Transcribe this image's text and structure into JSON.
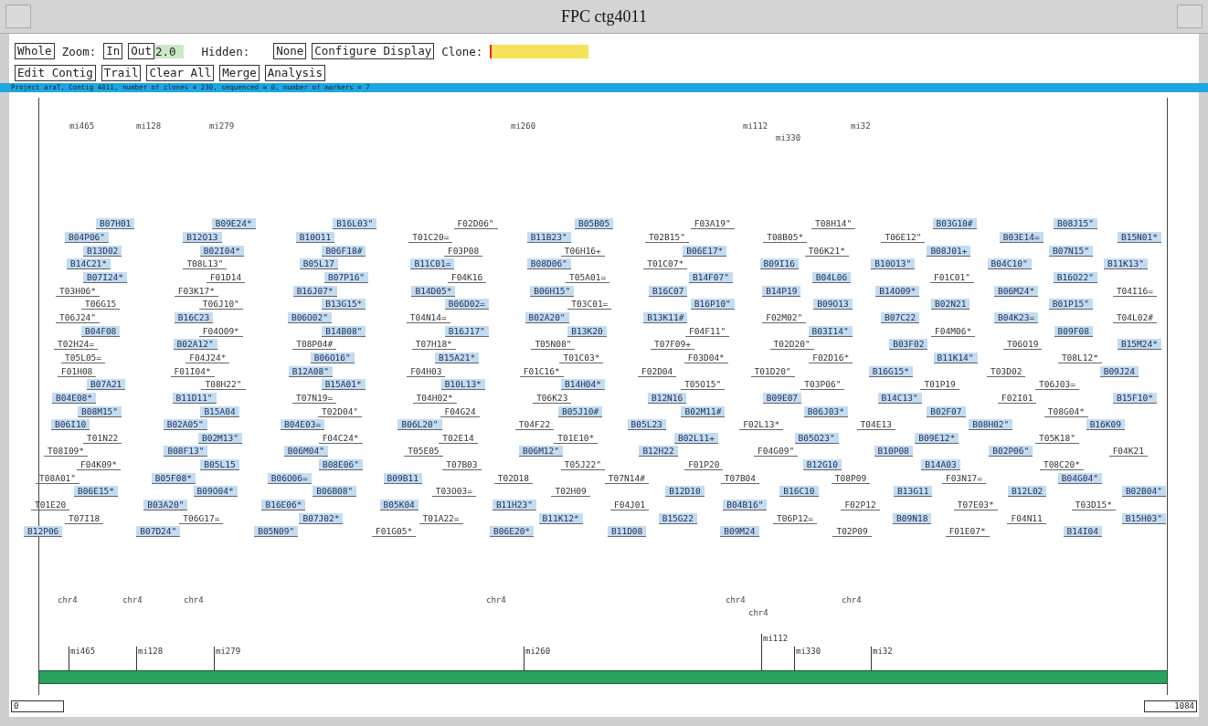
{
  "window": {
    "title": "FPC ctg4011"
  },
  "toolbar": [
    [
      {
        "kind": "button",
        "text": "Whole"
      },
      {
        "kind": "label",
        "text": "Zoom:"
      },
      {
        "kind": "button",
        "text": "In"
      },
      {
        "kind": "button",
        "text": "Out"
      },
      {
        "kind": "value",
        "text": "2.0"
      },
      {
        "kind": "label",
        "text": "Hidden:"
      },
      {
        "kind": "button",
        "text": "None"
      },
      {
        "kind": "button",
        "text": "Configure Display"
      },
      {
        "kind": "label",
        "text": "Clone:"
      },
      {
        "kind": "field"
      }
    ],
    [
      {
        "kind": "button",
        "text": "Edit Contig"
      },
      {
        "kind": "button",
        "text": "Trail"
      },
      {
        "kind": "button",
        "text": "Clear All"
      },
      {
        "kind": "button",
        "text": "Merge"
      },
      {
        "kind": "button",
        "text": "Analysis"
      }
    ]
  ],
  "status_line": "Project araT, Contig 4011, number of clones = 230, sequenced = 0, number of markers = 7",
  "marker_rows": [
    [
      "mi465",
      "mi128",
      "mi279",
      "mi260",
      "mi112",
      "mi32"
    ],
    [
      "mi330"
    ]
  ],
  "clone_rows": [
    [
      {
        "name": "B07H01",
        "highlighted": true
      },
      {
        "name": "B09E24*",
        "highlighted": true
      },
      {
        "name": "B16L03\"",
        "highlighted": true
      },
      {
        "name": "F02D06\"",
        "highlighted": false
      },
      {
        "name": "B05B05",
        "highlighted": true
      },
      {
        "name": "F03A19\"",
        "highlighted": false
      },
      {
        "name": "T08H14\"",
        "highlighted": false
      },
      {
        "name": "B03G10#",
        "highlighted": true
      },
      {
        "name": "B08J15\"",
        "highlighted": true
      }
    ],
    [
      {
        "name": "B04P06\"",
        "highlighted": true
      },
      {
        "name": "B12O13",
        "highlighted": true
      },
      {
        "name": "B10O11",
        "highlighted": true
      },
      {
        "name": "T01C20=",
        "highlighted": false
      },
      {
        "name": "B11B23\"",
        "highlighted": true
      },
      {
        "name": "T02B15\"",
        "highlighted": false
      },
      {
        "name": "T08B05*",
        "highlighted": false
      },
      {
        "name": "T06E12\"",
        "highlighted": false
      },
      {
        "name": "B03E14=",
        "highlighted": true
      },
      {
        "name": "B15N01*",
        "highlighted": true
      }
    ],
    [
      {
        "name": "B13D02",
        "highlighted": true
      },
      {
        "name": "B02I04*",
        "highlighted": true
      },
      {
        "name": "B06F18#",
        "highlighted": true
      },
      {
        "name": "F03P08",
        "highlighted": false
      },
      {
        "name": "T06H16+",
        "highlighted": false
      },
      {
        "name": "B06E17*",
        "highlighted": true
      },
      {
        "name": "T06K21*",
        "highlighted": false
      },
      {
        "name": "B08J01+",
        "highlighted": true
      },
      {
        "name": "B07N15\"",
        "highlighted": true
      }
    ],
    [
      {
        "name": "B14C21*",
        "highlighted": true
      },
      {
        "name": "T08L13\"",
        "highlighted": false
      },
      {
        "name": "B05L17",
        "highlighted": true
      },
      {
        "name": "B11C01=",
        "highlighted": true
      },
      {
        "name": "B08D06\"",
        "highlighted": true
      },
      {
        "name": "T01C07*",
        "highlighted": false
      },
      {
        "name": "B09I16",
        "highlighted": true
      },
      {
        "name": "B10O13\"",
        "highlighted": true
      },
      {
        "name": "B04C10\"",
        "highlighted": true
      },
      {
        "name": "B11K13\"",
        "highlighted": true
      }
    ],
    [
      {
        "name": "B07I24*",
        "highlighted": true
      },
      {
        "name": "F01D14",
        "highlighted": false
      },
      {
        "name": "B07P16\"",
        "highlighted": true
      },
      {
        "name": "F04K16",
        "highlighted": false
      },
      {
        "name": "T05A01=",
        "highlighted": false
      },
      {
        "name": "B14F07\"",
        "highlighted": true
      },
      {
        "name": "B04L06",
        "highlighted": true
      },
      {
        "name": "F01C01\"",
        "highlighted": false
      },
      {
        "name": "B16O22\"",
        "highlighted": true
      }
    ],
    [
      {
        "name": "T03H06*",
        "highlighted": false
      },
      {
        "name": "F03K17*",
        "highlighted": false
      },
      {
        "name": "B16J07*",
        "highlighted": true
      },
      {
        "name": "B14D05*",
        "highlighted": true
      },
      {
        "name": "B06H15\"",
        "highlighted": true
      },
      {
        "name": "B16C07",
        "highlighted": true
      },
      {
        "name": "B14P19",
        "highlighted": true
      },
      {
        "name": "B14O09*",
        "highlighted": true
      },
      {
        "name": "B06M24*",
        "highlighted": true
      },
      {
        "name": "T04I16=",
        "highlighted": false
      }
    ],
    [
      {
        "name": "T06G15",
        "highlighted": false
      },
      {
        "name": "T06J10\"",
        "highlighted": false
      },
      {
        "name": "B13G15*",
        "highlighted": true
      },
      {
        "name": "B06D02=",
        "highlighted": true
      },
      {
        "name": "T03C01=",
        "highlighted": false
      },
      {
        "name": "B16P10\"",
        "highlighted": true
      },
      {
        "name": "B09O13",
        "highlighted": true
      },
      {
        "name": "B02N21",
        "highlighted": true
      },
      {
        "name": "B01P15\"",
        "highlighted": true
      }
    ],
    [
      {
        "name": "T06J24\"",
        "highlighted": false
      },
      {
        "name": "B16C23",
        "highlighted": true
      },
      {
        "name": "B06O02\"",
        "highlighted": true
      },
      {
        "name": "T04N14=",
        "highlighted": false
      },
      {
        "name": "B02A20\"",
        "highlighted": true
      },
      {
        "name": "B13K11#",
        "highlighted": true
      },
      {
        "name": "F02M02\"",
        "highlighted": false
      },
      {
        "name": "B07C22",
        "highlighted": true
      },
      {
        "name": "B04K23=",
        "highlighted": true
      },
      {
        "name": "T04L02#",
        "highlighted": false
      }
    ],
    [
      {
        "name": "B04F08",
        "highlighted": true
      },
      {
        "name": "F04O09*",
        "highlighted": false
      },
      {
        "name": "B14B08\"",
        "highlighted": true
      },
      {
        "name": "B16J17\"",
        "highlighted": true
      },
      {
        "name": "B13K20",
        "highlighted": true
      },
      {
        "name": "F04F11\"",
        "highlighted": false
      },
      {
        "name": "B03I14\"",
        "highlighted": true
      },
      {
        "name": "F04M06*",
        "highlighted": false
      },
      {
        "name": "B09F08",
        "highlighted": true
      }
    ],
    [
      {
        "name": "T02H24=",
        "highlighted": false
      },
      {
        "name": "B02A12\"",
        "highlighted": true
      },
      {
        "name": "T08P04#",
        "highlighted": false
      },
      {
        "name": "T07H18*",
        "highlighted": false
      },
      {
        "name": "T05N08\"",
        "highlighted": false
      },
      {
        "name": "T07F09+",
        "highlighted": false
      },
      {
        "name": "T02D20\"",
        "highlighted": false
      },
      {
        "name": "B03F02",
        "highlighted": true
      },
      {
        "name": "T06O19",
        "highlighted": false
      },
      {
        "name": "B15M24*",
        "highlighted": true
      }
    ],
    [
      {
        "name": "T05L05=",
        "highlighted": false
      },
      {
        "name": "F04J24*",
        "highlighted": false
      },
      {
        "name": "B06O16\"",
        "highlighted": true
      },
      {
        "name": "B15A21*",
        "highlighted": true
      },
      {
        "name": "T01C03*",
        "highlighted": false
      },
      {
        "name": "F03D04*",
        "highlighted": false
      },
      {
        "name": "F02D16*",
        "highlighted": false
      },
      {
        "name": "B11K14\"",
        "highlighted": true
      },
      {
        "name": "T08L12*",
        "highlighted": false
      }
    ],
    [
      {
        "name": "F01H08",
        "highlighted": false
      },
      {
        "name": "F01I04*",
        "highlighted": false
      },
      {
        "name": "B12A08\"",
        "highlighted": true
      },
      {
        "name": "F04H03",
        "highlighted": false
      },
      {
        "name": "F01C16*",
        "highlighted": false
      },
      {
        "name": "F02D04",
        "highlighted": false
      },
      {
        "name": "T01D20\"",
        "highlighted": false
      },
      {
        "name": "B16G15*",
        "highlighted": true
      },
      {
        "name": "T03D02",
        "highlighted": false
      },
      {
        "name": "B09J24",
        "highlighted": true
      }
    ],
    [
      {
        "name": "B07A21",
        "highlighted": true
      },
      {
        "name": "T08H22\"",
        "highlighted": false
      },
      {
        "name": "B15A01*",
        "highlighted": true
      },
      {
        "name": "B10L13*",
        "highlighted": true
      },
      {
        "name": "B14H04*",
        "highlighted": true
      },
      {
        "name": "T05O15\"",
        "highlighted": false
      },
      {
        "name": "T03P06\"",
        "highlighted": false
      },
      {
        "name": "T01P19",
        "highlighted": false
      },
      {
        "name": "T06J03=",
        "highlighted": false
      }
    ],
    [
      {
        "name": "B04E08*",
        "highlighted": true
      },
      {
        "name": "B11D11\"",
        "highlighted": true
      },
      {
        "name": "T07N19=",
        "highlighted": false
      },
      {
        "name": "T04H02*",
        "highlighted": false
      },
      {
        "name": "T06K23",
        "highlighted": false
      },
      {
        "name": "B12N16",
        "highlighted": true
      },
      {
        "name": "B09E07",
        "highlighted": true
      },
      {
        "name": "B14C13\"",
        "highlighted": true
      },
      {
        "name": "F02I01",
        "highlighted": false
      },
      {
        "name": "B15F10*",
        "highlighted": true
      }
    ],
    [
      {
        "name": "B08M15\"",
        "highlighted": true
      },
      {
        "name": "B15A04",
        "highlighted": true
      },
      {
        "name": "T02D04\"",
        "highlighted": false
      },
      {
        "name": "F04G24",
        "highlighted": false
      },
      {
        "name": "B05J10#",
        "highlighted": true
      },
      {
        "name": "B02M11#",
        "highlighted": true
      },
      {
        "name": "B06J03*",
        "highlighted": true
      },
      {
        "name": "B02F07",
        "highlighted": true
      },
      {
        "name": "T08G04*",
        "highlighted": false
      }
    ],
    [
      {
        "name": "B06I10",
        "highlighted": true
      },
      {
        "name": "B02A05\"",
        "highlighted": true
      },
      {
        "name": "B04E03=",
        "highlighted": true
      },
      {
        "name": "B06L20\"",
        "highlighted": true
      },
      {
        "name": "T04F22",
        "highlighted": false
      },
      {
        "name": "B05L23",
        "highlighted": true
      },
      {
        "name": "F02L13*",
        "highlighted": false
      },
      {
        "name": "T04E13",
        "highlighted": false
      },
      {
        "name": "B08H02\"",
        "highlighted": true
      },
      {
        "name": "B16K09",
        "highlighted": true
      }
    ],
    [
      {
        "name": "T01N22",
        "highlighted": false
      },
      {
        "name": "B02M13\"",
        "highlighted": true
      },
      {
        "name": "F04C24*",
        "highlighted": false
      },
      {
        "name": "T02E14",
        "highlighted": false
      },
      {
        "name": "T01E10*",
        "highlighted": false
      },
      {
        "name": "B02L11+",
        "highlighted": true
      },
      {
        "name": "B05O23\"",
        "highlighted": true
      },
      {
        "name": "B09E12*",
        "highlighted": true
      },
      {
        "name": "T05K18\"",
        "highlighted": false
      }
    ],
    [
      {
        "name": "T08I09*",
        "highlighted": false
      },
      {
        "name": "B08F13\"",
        "highlighted": true
      },
      {
        "name": "B06M04\"",
        "highlighted": true
      },
      {
        "name": "T05E05",
        "highlighted": false
      },
      {
        "name": "B06M12\"",
        "highlighted": true
      },
      {
        "name": "B12H22",
        "highlighted": true
      },
      {
        "name": "F04G09\"",
        "highlighted": false
      },
      {
        "name": "B10P08",
        "highlighted": true
      },
      {
        "name": "B02P06\"",
        "highlighted": true
      },
      {
        "name": "F04K21",
        "highlighted": false
      }
    ],
    [
      {
        "name": "F04K09*",
        "highlighted": false
      },
      {
        "name": "B05L15",
        "highlighted": true
      },
      {
        "name": "B08E06\"",
        "highlighted": true
      },
      {
        "name": "T07B03",
        "highlighted": false
      },
      {
        "name": "T05J22\"",
        "highlighted": false
      },
      {
        "name": "F01P20",
        "highlighted": false
      },
      {
        "name": "B12G10",
        "highlighted": true
      },
      {
        "name": "B14A03",
        "highlighted": true
      },
      {
        "name": "T08C20*",
        "highlighted": false
      }
    ],
    [
      {
        "name": "T08A01\"",
        "highlighted": false
      },
      {
        "name": "B05F08*",
        "highlighted": true
      },
      {
        "name": "B06O06=",
        "highlighted": true
      },
      {
        "name": "B09B11",
        "highlighted": true
      },
      {
        "name": "T02D18",
        "highlighted": false
      },
      {
        "name": "T07N14#",
        "highlighted": false
      },
      {
        "name": "T07B04",
        "highlighted": false
      },
      {
        "name": "T08P09",
        "highlighted": false
      },
      {
        "name": "F03N17=",
        "highlighted": false
      },
      {
        "name": "B04G04\"",
        "highlighted": true
      }
    ],
    [
      {
        "name": "B06E15*",
        "highlighted": true
      },
      {
        "name": "B09O04*",
        "highlighted": true
      },
      {
        "name": "B06B08\"",
        "highlighted": true
      },
      {
        "name": "T03O03=",
        "highlighted": false
      },
      {
        "name": "T02H09",
        "highlighted": false
      },
      {
        "name": "B12D10",
        "highlighted": true
      },
      {
        "name": "B16C10",
        "highlighted": true
      },
      {
        "name": "B13G11",
        "highlighted": true
      },
      {
        "name": "B12L02",
        "highlighted": true
      },
      {
        "name": "B02B04\"",
        "highlighted": true
      }
    ],
    [
      {
        "name": "T01E20",
        "highlighted": false
      },
      {
        "name": "B03A20\"",
        "highlighted": true
      },
      {
        "name": "B16E06*",
        "highlighted": true
      },
      {
        "name": "B05K04",
        "highlighted": true
      },
      {
        "name": "B11H23\"",
        "highlighted": true
      },
      {
        "name": "F04J01",
        "highlighted": false
      },
      {
        "name": "B04B16\"",
        "highlighted": true
      },
      {
        "name": "F02P12",
        "highlighted": false
      },
      {
        "name": "T07E03*",
        "highlighted": false
      },
      {
        "name": "T03D15*",
        "highlighted": false
      }
    ],
    [
      {
        "name": "T07I18",
        "highlighted": false
      },
      {
        "name": "T06G17=",
        "highlighted": false
      },
      {
        "name": "B07J02*",
        "highlighted": true
      },
      {
        "name": "T01A22=",
        "highlighted": false
      },
      {
        "name": "B11K12*",
        "highlighted": true
      },
      {
        "name": "B15G22",
        "highlighted": true
      },
      {
        "name": "T06P12=",
        "highlighted": false
      },
      {
        "name": "B09N18",
        "highlighted": true
      },
      {
        "name": "F04N11",
        "highlighted": false
      },
      {
        "name": "B15H03\"",
        "highlighted": true
      }
    ],
    [
      {
        "name": "B12P06",
        "highlighted": true
      },
      {
        "name": "B07D24\"",
        "highlighted": true
      },
      {
        "name": "B05N09\"",
        "highlighted": true
      },
      {
        "name": "F01G05*",
        "highlighted": false
      },
      {
        "name": "B06E20*",
        "highlighted": true
      },
      {
        "name": "B11D08",
        "highlighted": true
      },
      {
        "name": "B09M24",
        "highlighted": true
      },
      {
        "name": "T02P09",
        "highlighted": false
      },
      {
        "name": "F01E07*",
        "highlighted": false
      },
      {
        "name": "B14I04",
        "highlighted": true
      }
    ]
  ],
  "chromosome_rows": [
    [
      "chr4",
      "chr4",
      "chr4",
      "chr4",
      "chr4",
      "chr4"
    ],
    [
      "chr4"
    ]
  ],
  "ruler_markers": [
    "mi465",
    "mi128",
    "mi279",
    "mi260",
    "mi112",
    "mi330",
    "mi32"
  ],
  "ruler": {
    "start": "0",
    "end": "1084"
  }
}
